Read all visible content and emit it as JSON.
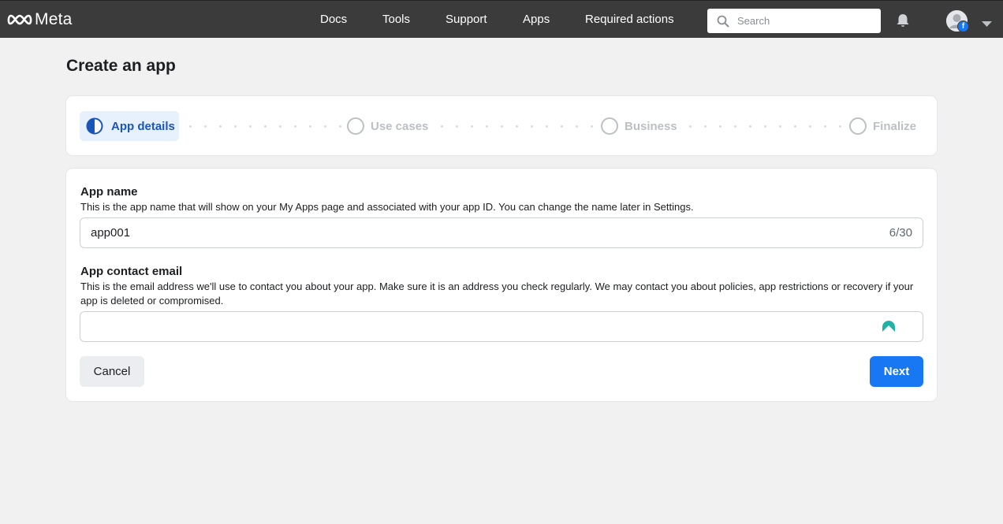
{
  "header": {
    "brand": "Meta",
    "nav": [
      "Docs",
      "Tools",
      "Support",
      "Apps",
      "Required actions"
    ],
    "search_placeholder": "Search",
    "icons": [
      "meta-logo-icon",
      "search-icon",
      "bell-icon",
      "avatar",
      "chevron-down-icon"
    ]
  },
  "page": {
    "title": "Create an app"
  },
  "stepper": {
    "steps": [
      {
        "label": "App details",
        "state": "active"
      },
      {
        "label": "Use cases",
        "state": "pending"
      },
      {
        "label": "Business",
        "state": "pending"
      },
      {
        "label": "Finalize",
        "state": "pending"
      }
    ]
  },
  "form": {
    "app_name": {
      "title": "App name",
      "description": "This is the app name that will show on your My Apps page and associated with your app ID. You can change the name later in Settings.",
      "value": "app001",
      "counter": "6/30"
    },
    "contact_email": {
      "title": "App contact email",
      "description": "This is the email address we'll use to contact you about your app. Make sure it is an address you check regularly. We may contact you about policies, app restrictions or recovery if your app is deleted or compromised.",
      "value": ""
    },
    "cancel_label": "Cancel",
    "next_label": "Next"
  },
  "colors": {
    "topbar": "#3b3b3b",
    "accent": "#1877f2",
    "active_step_bg": "#e7f0fd",
    "active_step_text": "#1a56b8"
  }
}
